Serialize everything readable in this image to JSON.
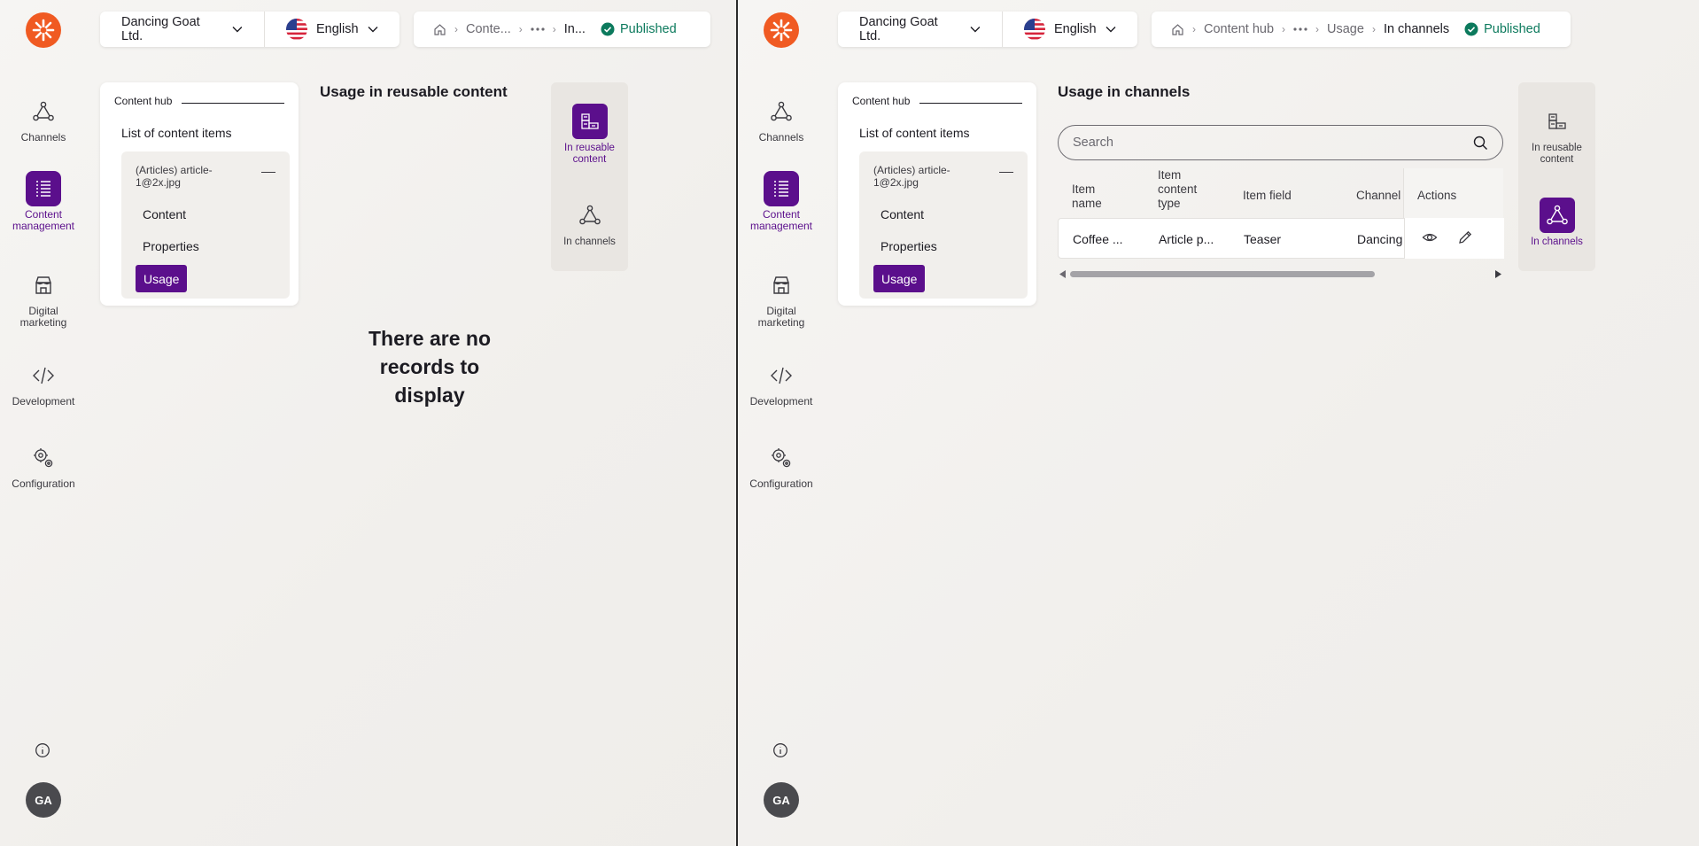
{
  "colors": {
    "accent": "#5b0f8c",
    "brand": "#f05a22",
    "published": "#0c7a5d"
  },
  "nav": {
    "items": [
      {
        "label": "Channels",
        "icon": "channels-icon"
      },
      {
        "label": "Content management",
        "icon": "content-management-icon"
      },
      {
        "label": "Digital marketing",
        "icon": "digital-marketing-icon"
      },
      {
        "label": "Development",
        "icon": "development-icon"
      },
      {
        "label": "Configuration",
        "icon": "configuration-icon"
      }
    ],
    "avatar": "GA"
  },
  "left": {
    "site": "Dancing Goat Ltd.",
    "language": "English",
    "breadcrumbs": [
      "Conte...",
      "In..."
    ],
    "status": "Published",
    "hub_title": "Content hub",
    "list_title": "List of content items",
    "item_name": "(Articles) article-1@2x.jpg",
    "sub_items": [
      "Content",
      "Properties",
      "Usage"
    ],
    "section_title": "Usage in reusable content",
    "switch": [
      "In reusable content",
      "In channels"
    ],
    "empty_message": "There are no records to display"
  },
  "right": {
    "site": "Dancing Goat Ltd.",
    "language": "English",
    "breadcrumbs": [
      "Content hub",
      "Usage",
      "In channels"
    ],
    "status": "Published",
    "hub_title": "Content hub",
    "list_title": "List of content items",
    "item_name": "(Articles) article-1@2x.jpg",
    "sub_items": [
      "Content",
      "Properties",
      "Usage"
    ],
    "section_title": "Usage in channels",
    "switch": [
      "In reusable content",
      "In channels"
    ],
    "search_placeholder": "Search",
    "table": {
      "columns": [
        "Item name",
        "Item content type",
        "Item field",
        "Channel",
        "Actions"
      ],
      "rows": [
        {
          "item_name": "Coffee ...",
          "content_type": "Article p...",
          "field": "Teaser",
          "channel": "Dancing"
        }
      ]
    }
  }
}
